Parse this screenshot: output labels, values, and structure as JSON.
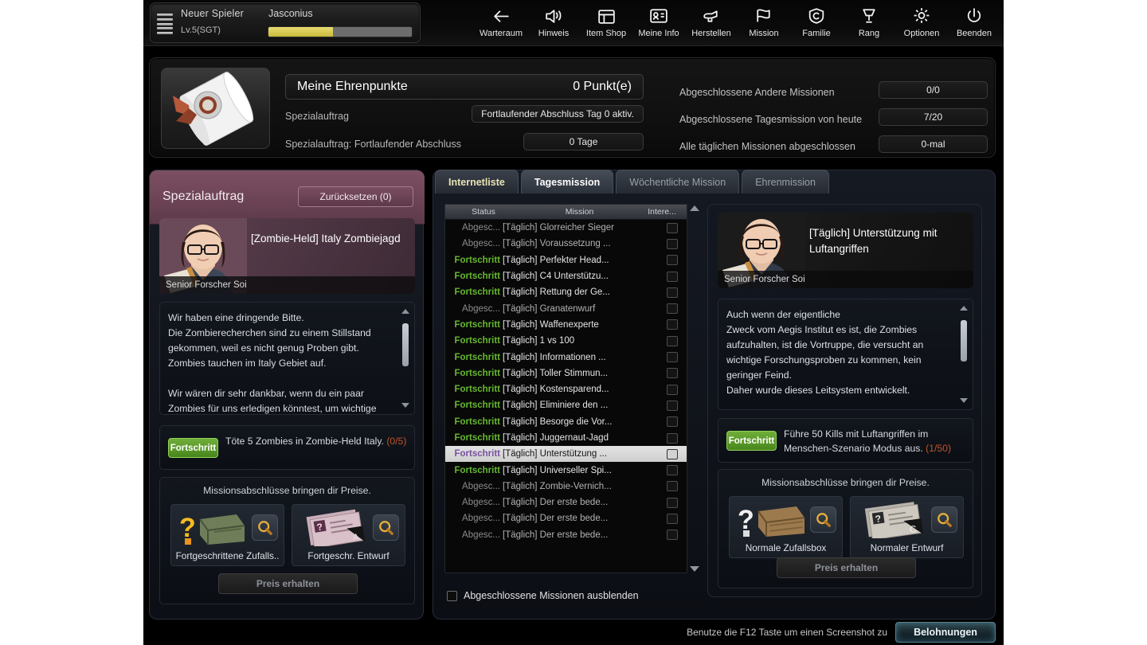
{
  "player": {
    "rank_label": "Neuer Spieler",
    "level": "Lv.5(SGT)",
    "nickname": "Jasconius",
    "xp_percent": 45
  },
  "nav": [
    {
      "icon": "back-arrow-icon",
      "label": "Warteraum"
    },
    {
      "icon": "speaker-icon",
      "label": "Hinweis"
    },
    {
      "icon": "shop-icon",
      "label": "Item Shop"
    },
    {
      "icon": "id-card-icon",
      "label": "Meine Info"
    },
    {
      "icon": "craft-hand-icon",
      "label": "Herstellen"
    },
    {
      "icon": "flag-icon",
      "label": "Mission"
    },
    {
      "icon": "shield-c-icon",
      "label": "Familie"
    },
    {
      "icon": "trophy-icon",
      "label": "Rang"
    },
    {
      "icon": "gear-icon",
      "label": "Optionen"
    },
    {
      "icon": "power-icon",
      "label": "Beenden"
    }
  ],
  "honor": {
    "icon": "scroll-certificate-icon",
    "title": "Meine Ehrenpunkte",
    "points_value": "0 Punkt(e)",
    "rows": [
      {
        "label": "Spezialauftrag",
        "value": "Fortlaufender Abschluss Tag 0 aktiv."
      },
      {
        "label": "Spezialauftrag: Fortlaufender Abschluss",
        "value": "0 Tage"
      }
    ],
    "stats": [
      {
        "label": "Abgeschlossene Andere Missionen",
        "value": "0/0"
      },
      {
        "label": "Abgeschlossene Tagesmission von heute",
        "value": "7/20"
      },
      {
        "label": "Alle täglichen Missionen abgeschlossen",
        "value": "0-mal"
      }
    ]
  },
  "special": {
    "panel_title": "Spezialauftrag",
    "reset_button": "Zurücksetzen (0)",
    "character_name": "Senior Forscher Soi",
    "mission_title": "[Zombie-Held] Italy Zombiejagd",
    "description": "Wir haben eine dringende Bitte.\nDie Zombierecherchen sind zu einem Stillstand gekommen, weil es nicht genug Proben gibt.\nZombies tauchen im Italy Gebiet auf.\n\nWir wären dir sehr dankbar, wenn du ein paar Zombies für uns erledigen könntest, um wichtige Proben erhalten zu können.",
    "progress_badge": "Fortschritt",
    "progress_text": "Töte 5 Zombies in Zombie-Held Italy.",
    "progress_count": "(0/5)",
    "prize_hint": "Missionsabschlüsse bringen dir Preise.",
    "prizes": [
      {
        "label": "Fortgeschrittene Zufalls..",
        "art": "green-crate-question-icon"
      },
      {
        "label": "Fortgeschr. Entwurf",
        "art": "blueprint-papers-icon"
      }
    ],
    "claim_button": "Preis erhalten"
  },
  "tabs": [
    {
      "label": "Internetliste",
      "state": "first"
    },
    {
      "label": "Tagesmission",
      "state": "active"
    },
    {
      "label": "Wöchentliche Mission",
      "state": "normal"
    },
    {
      "label": "Ehrenmission",
      "state": "normal"
    }
  ],
  "mission_table": {
    "columns": [
      "Status",
      "Mission",
      "Intere..."
    ],
    "sort_icon": "sort-ascending-icon",
    "rows": [
      {
        "status": "Abgesc...",
        "mission": "[Täglich] Glorreicher Sieger",
        "state": "done",
        "selected": false
      },
      {
        "status": "Abgesc...",
        "mission": "[Täglich] Voraussetzung ...",
        "state": "done",
        "selected": false
      },
      {
        "status": "Fortschritt",
        "mission": "[Täglich] Perfekter Head...",
        "state": "prog",
        "selected": false
      },
      {
        "status": "Fortschritt",
        "mission": "[Täglich] C4 Unterstützu...",
        "state": "prog",
        "selected": false
      },
      {
        "status": "Fortschritt",
        "mission": "[Täglich] Rettung der Ge...",
        "state": "prog",
        "selected": false
      },
      {
        "status": "Abgesc...",
        "mission": "[Täglich] Granatenwurf",
        "state": "done",
        "selected": false
      },
      {
        "status": "Fortschritt",
        "mission": "[Täglich] Waffenexperte",
        "state": "prog",
        "selected": false
      },
      {
        "status": "Fortschritt",
        "mission": "[Täglich] 1 vs 100",
        "state": "prog",
        "selected": false
      },
      {
        "status": "Fortschritt",
        "mission": "[Täglich] Informationen ...",
        "state": "prog",
        "selected": false
      },
      {
        "status": "Fortschritt",
        "mission": "[Täglich] Toller Stimmun...",
        "state": "prog",
        "selected": false
      },
      {
        "status": "Fortschritt",
        "mission": "[Täglich] Kostensparend...",
        "state": "prog",
        "selected": false
      },
      {
        "status": "Fortschritt",
        "mission": "[Täglich] Eliminiere den ...",
        "state": "prog",
        "selected": false
      },
      {
        "status": "Fortschritt",
        "mission": "[Täglich] Besorge die Vor...",
        "state": "prog",
        "selected": false
      },
      {
        "status": "Fortschritt",
        "mission": "[Täglich] Juggernaut-Jagd",
        "state": "prog",
        "selected": false
      },
      {
        "status": "Fortschritt",
        "mission": "[Täglich] Unterstützung ...",
        "state": "prog",
        "selected": true
      },
      {
        "status": "Fortschritt",
        "mission": "[Täglich] Universeller Spi...",
        "state": "prog",
        "selected": false
      },
      {
        "status": "Abgesc...",
        "mission": "[Täglich] Zombie-Vernich...",
        "state": "done",
        "selected": false
      },
      {
        "status": "Abgesc...",
        "mission": "[Täglich] Der erste bede...",
        "state": "done",
        "selected": false
      },
      {
        "status": "Abgesc...",
        "mission": "[Täglich] Der erste bede...",
        "state": "done",
        "selected": false
      },
      {
        "status": "Abgesc...",
        "mission": "[Täglich] Der erste bede...",
        "state": "done",
        "selected": false
      }
    ],
    "hide_completed_label": "Abgeschlossene Missionen ausblenden"
  },
  "detail": {
    "character_name": "Senior Forscher Soi",
    "mission_title": "[Täglich] Unterstützung mit Luftangriffen",
    "description": "Auch wenn der eigentliche\nZweck vom Aegis Institut es ist, die Zombies aufzuhalten, ist die Vortruppe, die versucht an wichtige Forschungsproben zu kommen, kein geringer Feind.\nDaher wurde dieses Leitsystem entwickelt.\n\nDein Auftrag ist es, die Koordinaten für einen",
    "progress_badge": "Fortschritt",
    "progress_text": "Führe 50 Kills mit Luftangriffen im Menschen-Szenario Modus aus.",
    "progress_count": "(1/50)",
    "prize_hint": "Missionsabschlüsse bringen dir Preise.",
    "prizes": [
      {
        "label": "Normale Zufallsbox",
        "art": "wood-crate-question-icon"
      },
      {
        "label": "Normaler Entwurf",
        "art": "newspaper-blueprint-icon"
      }
    ],
    "claim_button": "Preis erhalten"
  },
  "footer": {
    "hint": "Benutze die F12 Taste um einen Screenshot zu",
    "rewards_button": "Belohnungen"
  },
  "colors": {
    "progress_green": "#65b830",
    "selected_purple": "#7a4fa0",
    "count_orange": "#c0542e",
    "special_magenta": "#6b4354",
    "xp_yellow": "#c9b93c"
  }
}
